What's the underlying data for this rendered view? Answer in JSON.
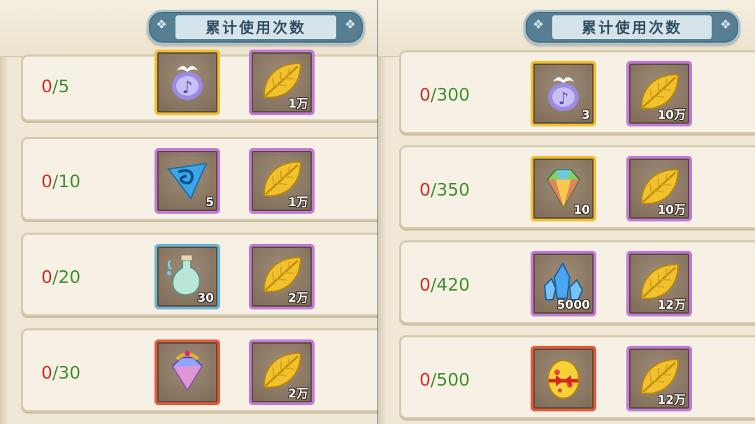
{
  "left_panel": {
    "title": "累计使用次数",
    "rows": [
      {
        "current": "0",
        "total": "5",
        "item": {
          "icon": "music-note-orb-icon",
          "rarity": "gold",
          "quantity": ""
        },
        "reward": {
          "icon": "gold-leaf-icon",
          "quantity": "1万"
        }
      },
      {
        "current": "0",
        "total": "10",
        "item": {
          "icon": "blue-swirl-crystal-icon",
          "rarity": "purple",
          "quantity": "5"
        },
        "reward": {
          "icon": "gold-leaf-icon",
          "quantity": "1万"
        }
      },
      {
        "current": "0",
        "total": "20",
        "item": {
          "icon": "potion-bottle-icon",
          "rarity": "blue",
          "quantity": "30"
        },
        "reward": {
          "icon": "gold-leaf-icon",
          "quantity": "2万"
        }
      },
      {
        "current": "0",
        "total": "30",
        "item": {
          "icon": "rainbow-gem-crown-icon",
          "rarity": "orange",
          "quantity": ""
        },
        "reward": {
          "icon": "gold-leaf-icon",
          "quantity": "2万"
        }
      }
    ]
  },
  "right_panel": {
    "title": "累计使用次数",
    "rows": [
      {
        "current": "0",
        "total": "300",
        "item": {
          "icon": "music-note-orb-icon",
          "rarity": "gold",
          "quantity": "3"
        },
        "reward": {
          "icon": "gold-leaf-icon",
          "quantity": "10万"
        }
      },
      {
        "current": "0",
        "total": "350",
        "item": {
          "icon": "rainbow-diamond-icon",
          "rarity": "gold",
          "quantity": "10"
        },
        "reward": {
          "icon": "gold-leaf-icon",
          "quantity": "10万"
        }
      },
      {
        "current": "0",
        "total": "420",
        "item": {
          "icon": "blue-crystal-cluster-icon",
          "rarity": "purple",
          "quantity": "5000"
        },
        "reward": {
          "icon": "gold-leaf-icon",
          "quantity": "12万"
        }
      },
      {
        "current": "0",
        "total": "500",
        "item": {
          "icon": "red-ribbon-egg-icon",
          "rarity": "orange",
          "quantity": ""
        },
        "reward": {
          "icon": "gold-leaf-icon",
          "quantity": "12万"
        }
      }
    ]
  },
  "colors": {
    "current_count": "#d62b24",
    "total_count": "#3f8f2f",
    "title_plate": "#577f94"
  }
}
